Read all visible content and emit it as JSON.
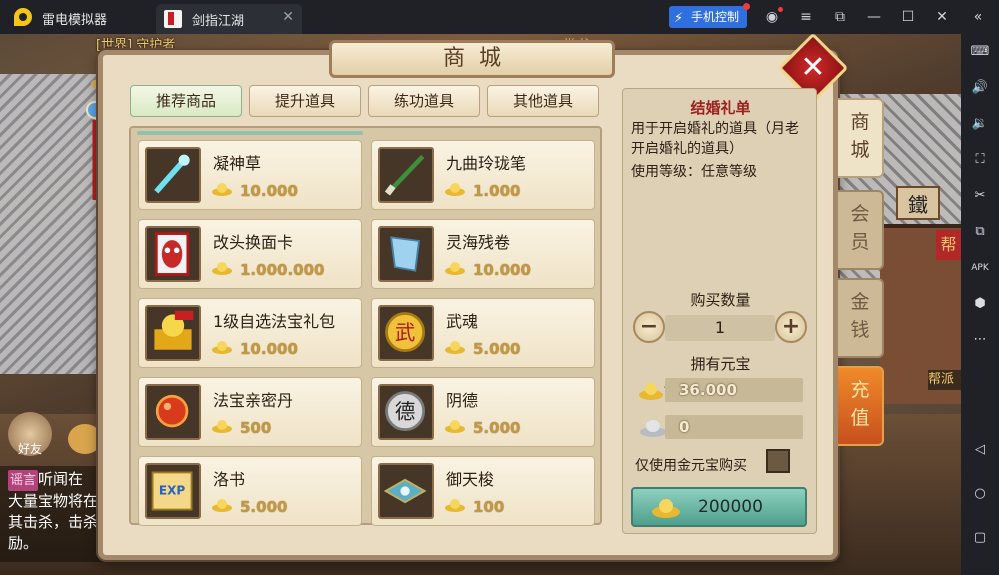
{
  "emulator": {
    "app_title": "雷电模拟器",
    "tab_label": "剑指江湖",
    "phone_control_label": "手机控制",
    "colors": {
      "bar": "#1f2126",
      "accent": "#2f6fe0"
    }
  },
  "game": {
    "world_tag": "[世界] 守护者",
    "world_right": "~ 堂书 ~",
    "friend_label": "好友",
    "chat": {
      "tag": "谣言",
      "line1": "听闻在",
      "line2": "大量宝物将在",
      "line3": "其击杀，击杀",
      "line4": "励。"
    },
    "sign_tie": "鐵",
    "sign_bang": "帮",
    "sign_bangpai": "帮派"
  },
  "shop": {
    "title": "商城",
    "close_icon": "close-icon",
    "tabs": [
      {
        "label": "推荐商品",
        "active": true
      },
      {
        "label": "提升道具",
        "active": false
      },
      {
        "label": "练功道具",
        "active": false
      },
      {
        "label": "其他道具",
        "active": false
      }
    ],
    "items": [
      {
        "name": "凝神草",
        "price": "10.000",
        "icon": "herb-icon"
      },
      {
        "name": "九曲玲珑笔",
        "price": "1.000",
        "icon": "brush-icon"
      },
      {
        "name": "改头换面卡",
        "price": "1.000.000",
        "icon": "mask-card-icon"
      },
      {
        "name": "灵海残卷",
        "price": "10.000",
        "icon": "scroll-fragment-icon"
      },
      {
        "name": "1级自选法宝礼包",
        "price": "10.000",
        "icon": "treasure-pack-icon"
      },
      {
        "name": "武魂",
        "price": "5.000",
        "icon": "martial-soul-icon"
      },
      {
        "name": "法宝亲密丹",
        "price": "500",
        "icon": "pill-icon"
      },
      {
        "name": "阴德",
        "price": "5.000",
        "icon": "virtue-icon"
      },
      {
        "name": "洛书",
        "price": "5.000",
        "icon": "exp-book-icon"
      },
      {
        "name": "御天梭",
        "price": "100",
        "icon": "shuttle-icon"
      }
    ],
    "detail": {
      "title": "结婚礼单",
      "desc": "用于开启婚礼的道具（月老开启婚礼的道具）",
      "usage": "使用等级：任意等级",
      "qty_label": "购买数量",
      "qty_value": "1",
      "own_label": "拥有元宝",
      "gold_amount": "36.000",
      "silver_amount": "0",
      "gold_only_label": "仅使用金元宝购买",
      "gold_only_checked": false,
      "buy_price": "200000"
    },
    "side_tabs": [
      {
        "label": "商城",
        "state": "active"
      },
      {
        "label": "会员",
        "state": "normal"
      },
      {
        "label": "金钱",
        "state": "normal"
      },
      {
        "label": "充值",
        "state": "recharge"
      }
    ],
    "colors": {
      "price_gold": "#c49840",
      "detail_title": "#9c2020",
      "buy_button": "#6fb8a6"
    }
  }
}
